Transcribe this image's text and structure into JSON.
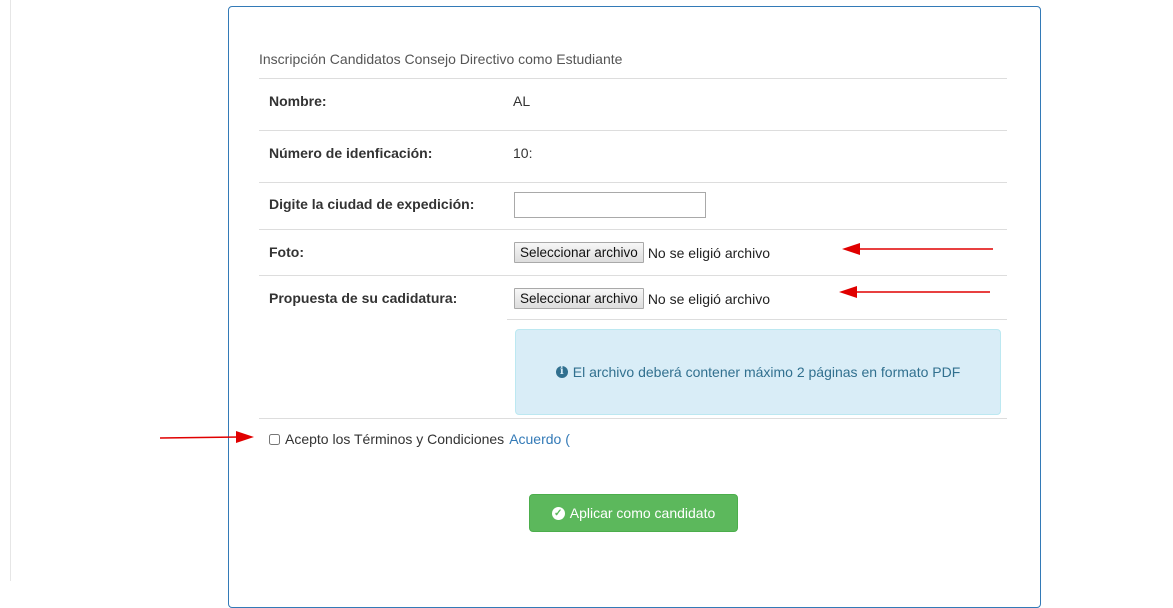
{
  "form": {
    "heading": "Inscripción Candidatos Consejo Directivo como Estudiante",
    "fields": {
      "name_label": "Nombre:",
      "name_value": "AL",
      "id_label": "Número de idenficación:",
      "id_value": "10:",
      "city_label": "Digite la ciudad de expedición:",
      "city_value": "",
      "photo_label": "Foto:",
      "proposal_label": "Propuesta de su cadidatura:"
    },
    "file_input": {
      "button_label": "Seleccionar archivo",
      "status_text": "No se eligió archivo"
    },
    "info_alert": {
      "icon": "info-circle-icon",
      "text": "El archivo deberá contener máximo 2 páginas en formato PDF"
    },
    "terms": {
      "text": "Acepto los Términos y Condiciones",
      "link_text": "Acuerdo (",
      "checked": false
    },
    "submit": {
      "icon": "check-circle-icon",
      "label": "Aplicar como candidato"
    }
  },
  "colors": {
    "panel_border": "#337ab7",
    "alert_bg": "#d9edf7",
    "alert_text": "#31708f",
    "success": "#5cb85c",
    "annotation_arrow": "#e00000"
  }
}
